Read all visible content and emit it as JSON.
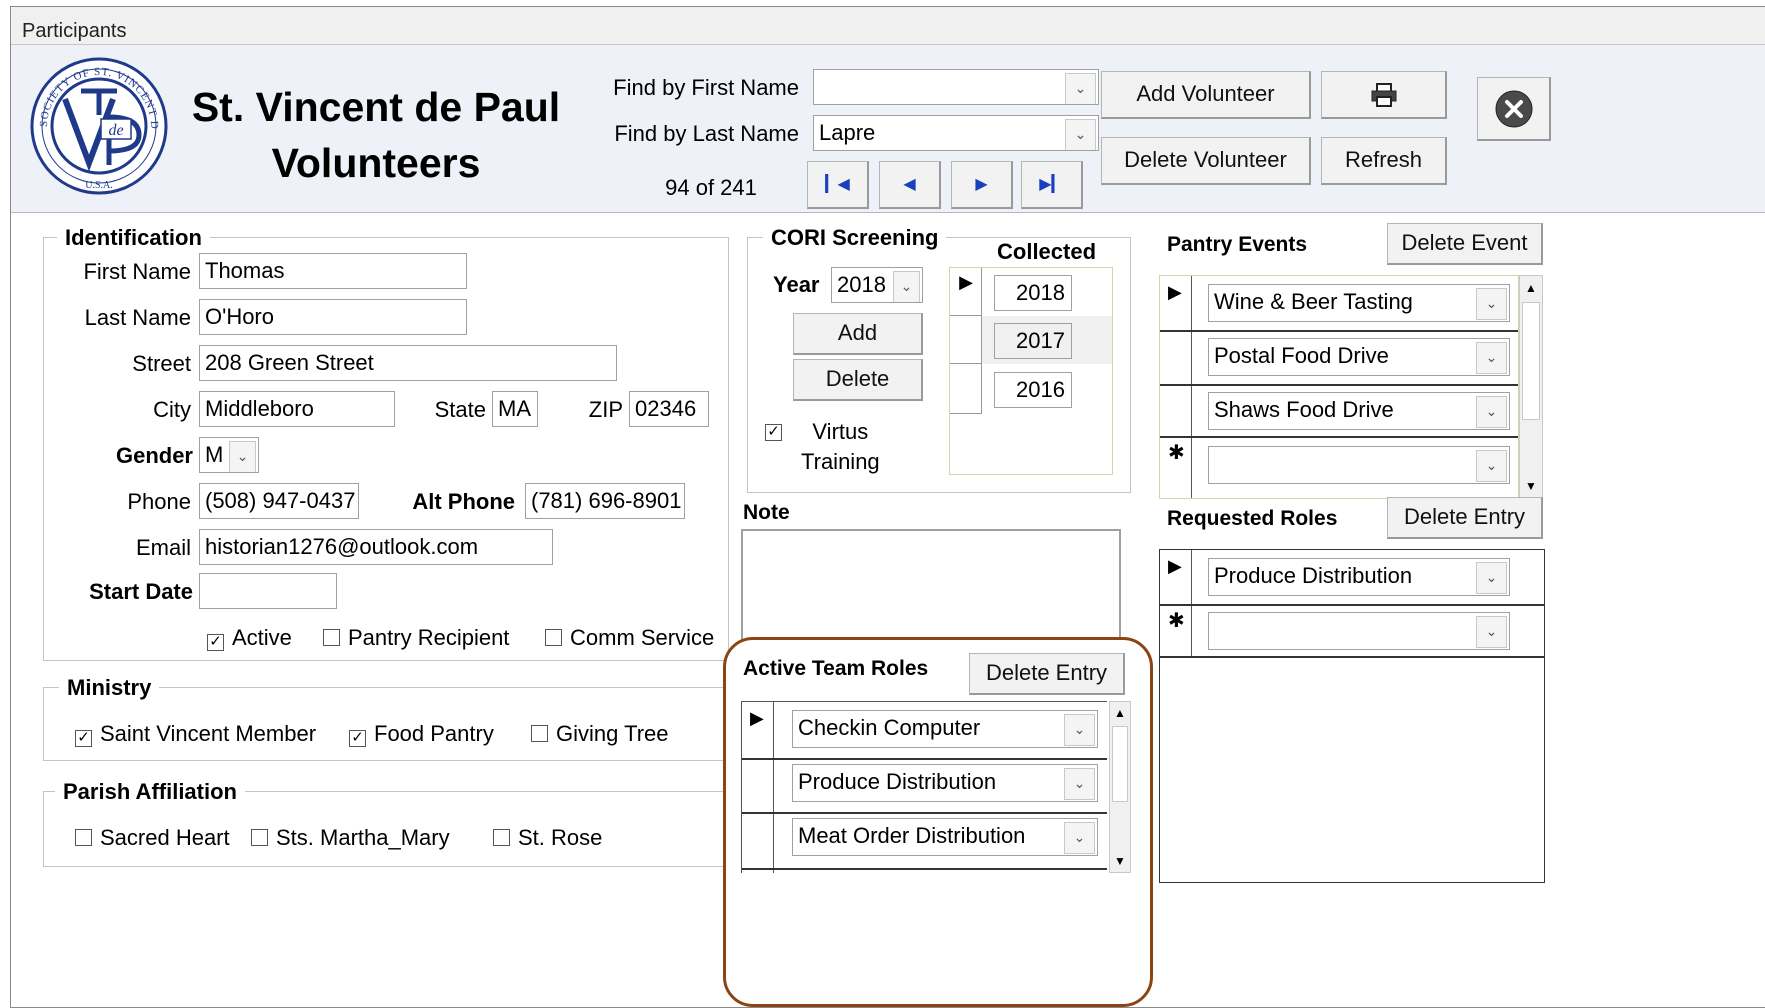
{
  "window": {
    "title": "Participants"
  },
  "header": {
    "title_line1": "St. Vincent de Paul",
    "title_line2": "Volunteers",
    "logo": {
      "icon": "svdp-logo-icon",
      "ring_text": "SOCIETY OF ST. VINCENT DE PAUL",
      "bottom_text": "U.S.A.",
      "monogram": "de"
    },
    "find_first_label": "Find by First Name",
    "find_first_value": "",
    "find_last_label": "Find by Last Name",
    "find_last_value": "Lapre",
    "record_position": "94 of 241",
    "add_volunteer": "Add Volunteer",
    "delete_volunteer": "Delete Volunteer",
    "refresh": "Refresh",
    "print_icon": "printer-icon",
    "close_icon": "close-icon"
  },
  "identification": {
    "legend": "Identification",
    "first_name_label": "First Name",
    "first_name": "Thomas",
    "last_name_label": "Last Name",
    "last_name": "O'Horo",
    "street_label": "Street",
    "street": "208 Green Street",
    "city_label": "City",
    "city": "Middleboro",
    "state_label": "State",
    "state": "MA",
    "zip_label": "ZIP",
    "zip": "02346",
    "gender_label": "Gender",
    "gender": "M",
    "phone_label": "Phone",
    "phone": "(508) 947-0437",
    "alt_phone_label": "Alt Phone",
    "alt_phone": "(781) 696-8901",
    "email_label": "Email",
    "email": "historian1276@outlook.com",
    "start_date_label": "Start Date",
    "start_date": "",
    "active_label": "Active",
    "active": true,
    "pantry_recipient_label": "Pantry Recipient",
    "pantry_recipient": false,
    "comm_service_label": "Comm Service",
    "comm_service": false
  },
  "ministry": {
    "legend": "Ministry",
    "saint_vincent_member_label": "Saint Vincent Member",
    "saint_vincent_member": true,
    "food_pantry_label": "Food Pantry",
    "food_pantry": true,
    "giving_tree_label": "Giving Tree",
    "giving_tree": false
  },
  "parish": {
    "legend": "Parish Affiliation",
    "sacred_heart_label": "Sacred Heart",
    "sacred_heart": false,
    "sts_martha_mary_label": "Sts. Martha_Mary",
    "sts_martha_mary": false,
    "st_rose_label": "St. Rose",
    "st_rose": false
  },
  "cori": {
    "legend": "CORI Screening",
    "year_label": "Year",
    "year": "2018",
    "add": "Add",
    "delete": "Delete",
    "virtus_line1": "Virtus",
    "virtus_line2": "Training",
    "virtus": true,
    "collected_label": "Collected",
    "collected": [
      "2018",
      "2017",
      "2016"
    ]
  },
  "note": {
    "label": "Note",
    "value": ""
  },
  "active_team_roles": {
    "label": "Active Team Roles",
    "delete_entry": "Delete Entry",
    "rows": [
      "Checkin Computer",
      "Produce Distribution",
      "Meat Order Distribution"
    ]
  },
  "pantry_events": {
    "label": "Pantry Events",
    "delete_event": "Delete Event",
    "rows": [
      "Wine & Beer Tasting",
      "Postal Food Drive",
      "Shaws Food Drive"
    ]
  },
  "requested_roles": {
    "label": "Requested Roles",
    "delete_entry": "Delete Entry",
    "rows": [
      "Produce Distribution"
    ]
  },
  "colors": {
    "highlight_border": "#8b4513",
    "header_bg": "#eef1f7",
    "nav_arrow": "#1a3fbf"
  }
}
